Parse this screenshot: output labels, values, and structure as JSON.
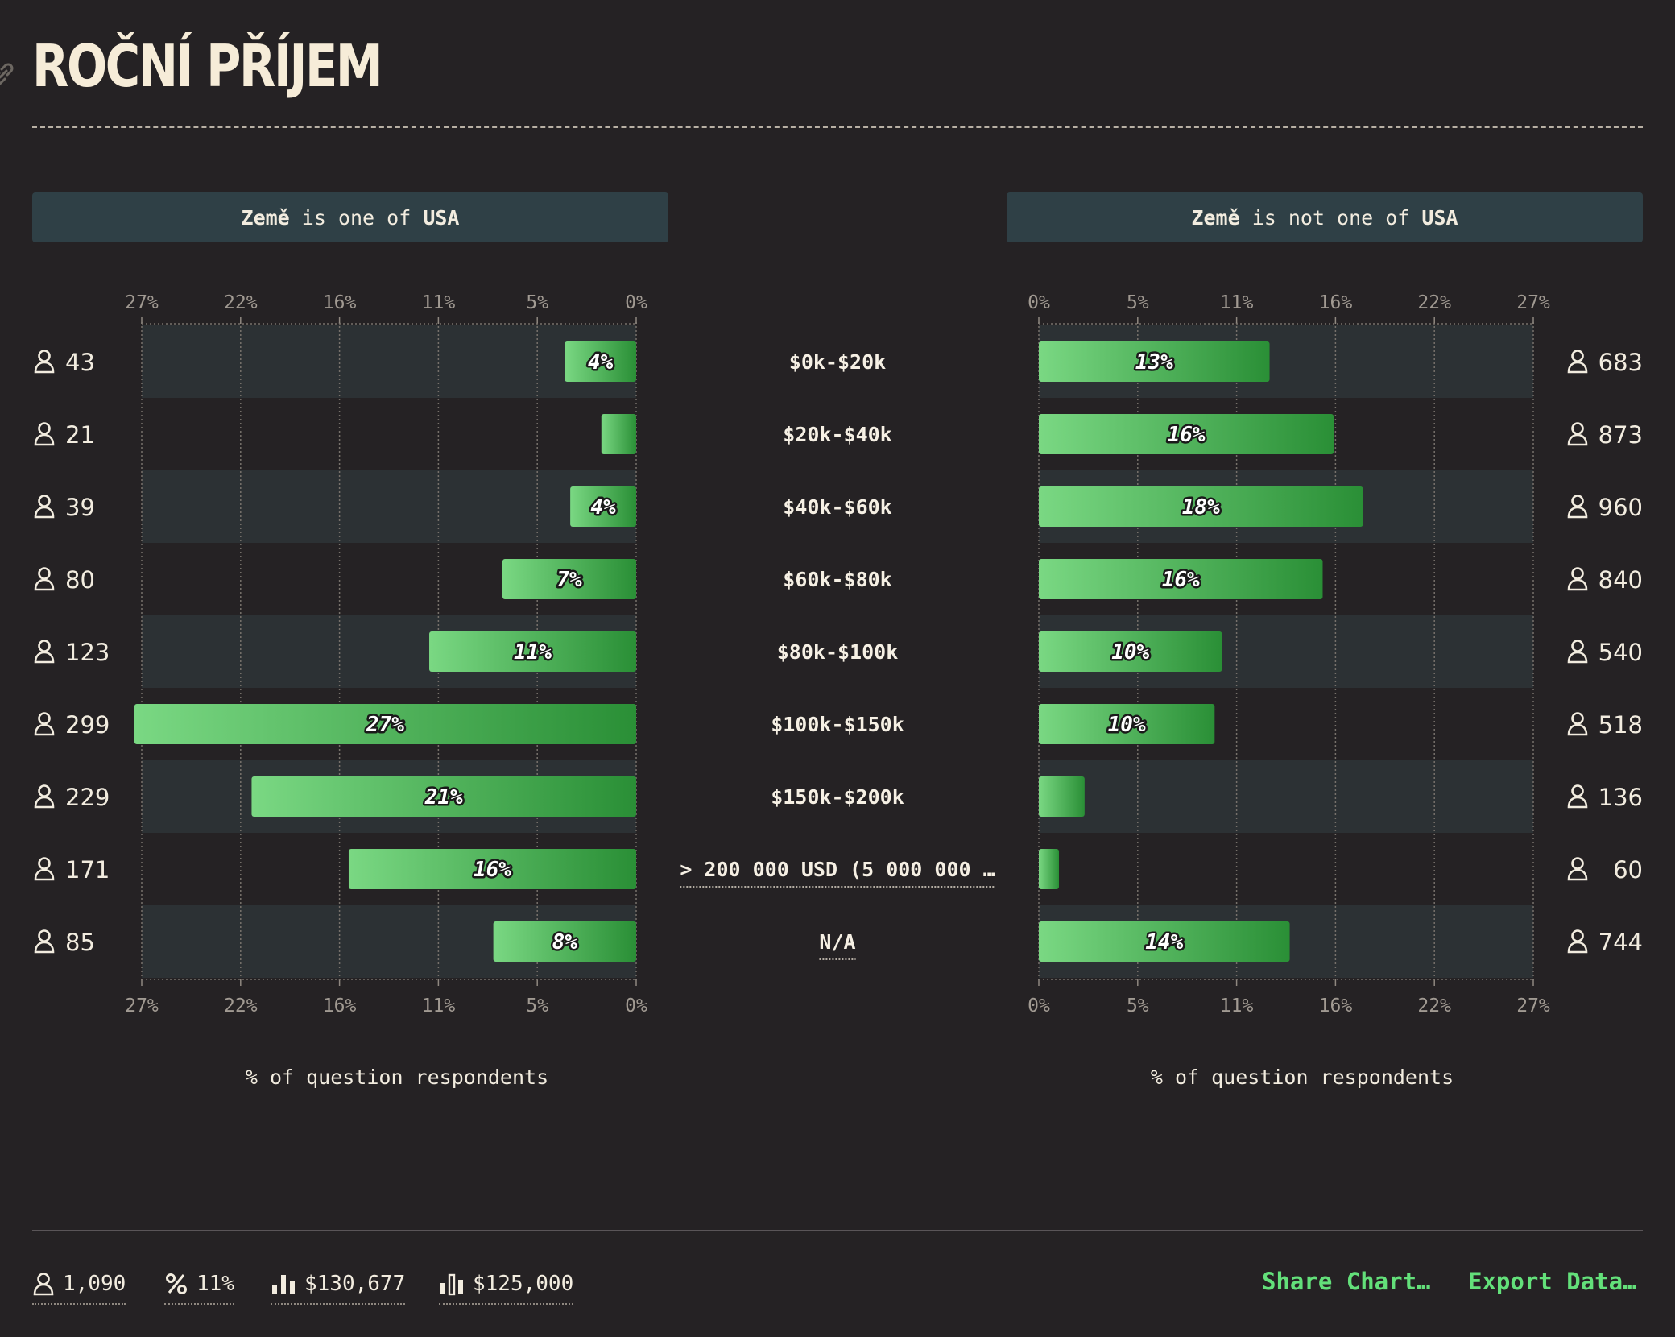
{
  "page": {
    "title": "ROČNÍ PŘÍJEM",
    "accent_color": "#63e07a"
  },
  "filters": {
    "left": {
      "field": "Země",
      "middle": " is one of ",
      "value": "USA"
    },
    "right": {
      "field": "Země",
      "middle": " is not one of ",
      "value": "USA"
    }
  },
  "chart_data": {
    "type": "bar",
    "orientation": "horizontal-diverging",
    "categories": [
      "$0k-$20k",
      "$20k-$40k",
      "$40k-$60k",
      "$60k-$80k",
      "$80k-$100k",
      "$100k-$150k",
      "$150k-$200k",
      "> 200 000 USD (5 000 000 …",
      "N/A"
    ],
    "axis_ticks": [
      "0%",
      "5%",
      "11%",
      "16%",
      "22%",
      "27%"
    ],
    "axis_max": 27,
    "series": [
      {
        "name": "Země is one of USA",
        "values": [
          3.9,
          1.9,
          3.6,
          7.3,
          11.3,
          27.4,
          21.0,
          15.7,
          7.8
        ],
        "labels": [
          "4%",
          "",
          "4%",
          "7%",
          "11%",
          "27%",
          "21%",
          "16%",
          "8%"
        ],
        "counts": [
          "43",
          "21",
          "39",
          "80",
          "123",
          "299",
          "229",
          "171",
          "85"
        ],
        "xlabel": "% of question respondents"
      },
      {
        "name": "Země is not one of USA",
        "values": [
          12.6,
          16.1,
          17.7,
          15.5,
          10.0,
          9.6,
          2.5,
          1.1,
          13.7
        ],
        "labels": [
          "13%",
          "16%",
          "18%",
          "16%",
          "10%",
          "10%",
          "",
          "",
          "14%"
        ],
        "counts": [
          "683",
          "873",
          "960",
          "840",
          "540",
          "518",
          "136",
          "60",
          "744"
        ],
        "xlabel": "% of question respondents"
      }
    ],
    "grid": true,
    "bar_gradient": [
      "#7ad883",
      "#2a8f36"
    ]
  },
  "footer": {
    "respondents": "1,090",
    "percent": "11%",
    "mean": "$130,677",
    "median": "$125,000",
    "share_label": "Share Chart…",
    "export_label": "Export Data…"
  }
}
